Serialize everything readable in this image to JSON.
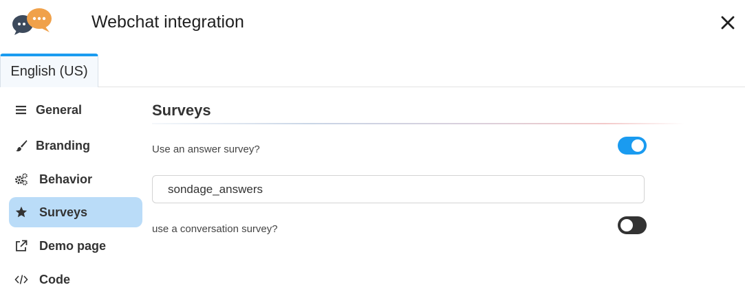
{
  "header": {
    "title": "Webchat integration",
    "logo_icon": "chat-bubbles-logo",
    "close_icon": "close-icon"
  },
  "tabs": [
    {
      "label": "English (US)",
      "active": true
    }
  ],
  "sidebar": {
    "items": [
      {
        "label": "General",
        "icon": "hamburger-icon",
        "active": false
      },
      {
        "label": "Branding",
        "icon": "paintbrush-icon",
        "active": false
      },
      {
        "label": "Behavior",
        "icon": "gears-icon",
        "active": false
      },
      {
        "label": "Surveys",
        "icon": "star-icon",
        "active": true
      },
      {
        "label": "Demo page",
        "icon": "external-link-icon",
        "active": false
      },
      {
        "label": "Code",
        "icon": "code-icon",
        "active": false
      }
    ]
  },
  "main": {
    "section_title": "Surveys",
    "answer_survey": {
      "label": "Use an answer survey?",
      "enabled": true,
      "value": "sondage_answers"
    },
    "conversation_survey": {
      "label": "use a conversation survey?",
      "enabled": false
    }
  },
  "colors": {
    "accent": "#1a9bf0",
    "active_nav_bg": "#badcf8",
    "toggle_off": "#333333"
  }
}
